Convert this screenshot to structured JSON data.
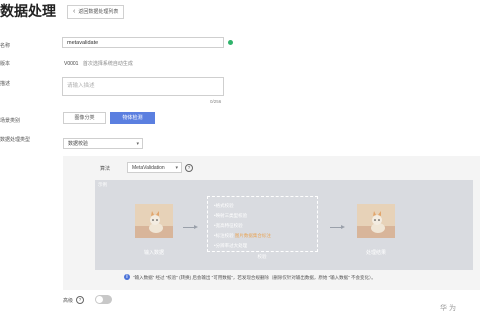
{
  "header": {
    "title": "数据处理",
    "back_label": "返回数据处理列表"
  },
  "form": {
    "name": {
      "label": "名称",
      "value": "metavalidate"
    },
    "version": {
      "label": "版本",
      "value": "V0001",
      "hint": "首次选择系统自动生成"
    },
    "description": {
      "label": "描述",
      "placeholder": "请输入描述",
      "counter": "0/256"
    },
    "scenario": {
      "label": "场景类别",
      "options": [
        "图像分类",
        "物体检测"
      ],
      "selected": "物体检测"
    },
    "processing_type": {
      "label": "数据处理类型",
      "value": "数据校验"
    }
  },
  "operator": {
    "label": "算法",
    "value": "MetaValidation",
    "help": "?",
    "illustration": {
      "header": "示例",
      "input_caption": "输入数据",
      "output_caption": "处理结果",
      "checks": [
        "•格式校验",
        "•映射三类型校验",
        "•宽高特征校验",
        "•标注校验",
        "•分辨率过大处理"
      ],
      "checks_highlight": "图片数据集合标注",
      "center_caption": "校验"
    },
    "note": "\"输入数据\" 经过 \"校验\" (转换) 后会输出 \"可用数据\"，若发现合规删除（删除仅针对输出数据，原始 \"输入数据\" 不会变化）。"
  },
  "advanced": {
    "label": "高级",
    "help": "?",
    "enabled": false
  },
  "watermark": "华为"
}
